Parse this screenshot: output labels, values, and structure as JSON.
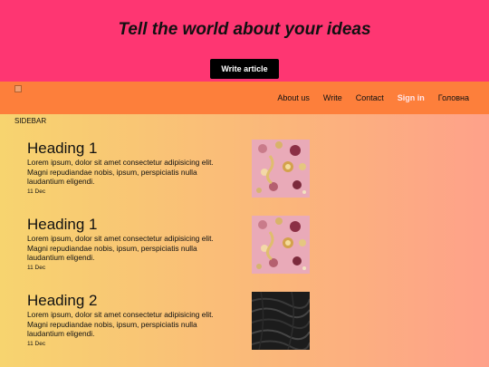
{
  "hero": {
    "title": "Tell the world about your ideas",
    "button_label": "Write article"
  },
  "nav": {
    "links": [
      "About us",
      "Write",
      "Contact",
      "Sign in",
      "Головна"
    ]
  },
  "sidebar": {
    "label": "SIDEBAR"
  },
  "posts": [
    {
      "heading": "Heading 1",
      "excerpt": "Lorem ipsum, dolor sit amet consectetur adipisicing elit. Magni repudiandae nobis, ipsum, perspiciatis nulla laudantium eligendi.",
      "date": "11 Dec",
      "image": "festive-ornaments-pink"
    },
    {
      "heading": "Heading 1",
      "excerpt": "Lorem ipsum, dolor sit amet consectetur adipisicing elit. Magni repudiandae nobis, ipsum, perspiciatis nulla laudantium eligendi.",
      "date": "11 Dec",
      "image": "festive-ornaments-pink"
    },
    {
      "heading": "Heading 2",
      "excerpt": "Lorem ipsum, dolor sit amet consectetur adipisicing elit. Magni repudiandae nobis, ipsum, perspiciatis nulla laudantium eligendi.",
      "date": "11 Dec",
      "image": "dark-feathers"
    }
  ],
  "colors": {
    "hero_bg": "#fe3672",
    "nav_bg": "#fd7f3b",
    "main_gradient_start": "#f7d46f",
    "main_gradient_end": "#fea18a",
    "active_link": "#ffe6ea"
  }
}
